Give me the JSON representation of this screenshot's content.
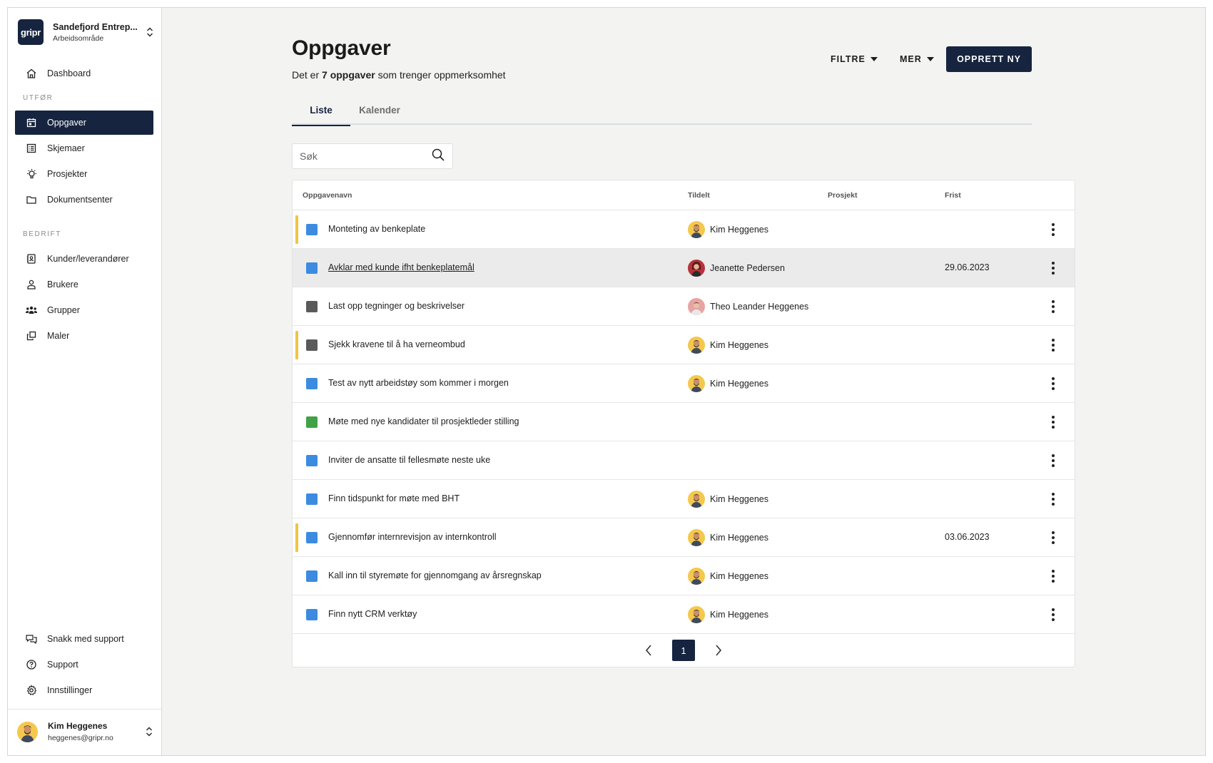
{
  "org": {
    "logo": "gripr",
    "name": "Sandefjord Entrep...",
    "subtitle": "Arbeidsområde"
  },
  "nav": {
    "dashboard": "Dashboard",
    "section_utfor": "UTFØR",
    "oppgaver": "Oppgaver",
    "skjemaer": "Skjemaer",
    "prosjekter": "Prosjekter",
    "dokumentsenter": "Dokumentsenter",
    "section_bedrift": "BEDRIFT",
    "kunder": "Kunder/leverandører",
    "brukere": "Brukere",
    "grupper": "Grupper",
    "maler": "Maler",
    "snakk": "Snakk med support",
    "support": "Support",
    "innstillinger": "Innstillinger"
  },
  "user": {
    "name": "Kim Heggenes",
    "email": "heggenes@gripr.no"
  },
  "page": {
    "title": "Oppgaver",
    "subtitle_pre": "Det er ",
    "subtitle_bold": "7 oppgaver",
    "subtitle_post": " som trenger oppmerksomhet"
  },
  "header": {
    "filter": "FILTRE",
    "more": "MER",
    "create": "OPPRETT NY"
  },
  "tabs": {
    "list": "Liste",
    "calendar": "Kalender"
  },
  "search": {
    "placeholder": "Søk"
  },
  "table": {
    "headers": {
      "name": "Oppgavenavn",
      "assigned": "Tildelt",
      "project": "Prosjekt",
      "due": "Frist"
    },
    "rows": [
      {
        "name": "Monteting av benkeplate",
        "assignee": "Kim Heggenes",
        "due": ""
      },
      {
        "name": "Avklar med kunde ifht benkeplatemål",
        "assignee": "Jeanette Pedersen",
        "due": "29.06.2023"
      },
      {
        "name": "Last opp tegninger og beskrivelser",
        "assignee": "Theo Leander Heggenes",
        "due": ""
      },
      {
        "name": "Sjekk kravene til å ha verneombud",
        "assignee": "Kim Heggenes",
        "due": ""
      },
      {
        "name": "Test av nytt arbeidstøy som kommer i morgen",
        "assignee": "Kim Heggenes",
        "due": ""
      },
      {
        "name": "Møte med nye kandidater til prosjektleder stilling",
        "assignee": "",
        "due": ""
      },
      {
        "name": "Inviter de ansatte til fellesmøte neste uke",
        "assignee": "",
        "due": ""
      },
      {
        "name": "Finn tidspunkt for møte med BHT",
        "assignee": "Kim Heggenes",
        "due": ""
      },
      {
        "name": "Gjennomfør internrevisjon av internkontroll",
        "assignee": "Kim Heggenes",
        "due": "03.06.2023"
      },
      {
        "name": "Kall inn til styremøte for gjennomgang av årsregnskap",
        "assignee": "Kim Heggenes",
        "due": ""
      },
      {
        "name": "Finn nytt CRM verktøy",
        "assignee": "Kim Heggenes",
        "due": ""
      }
    ]
  },
  "pagination": {
    "current": "1"
  },
  "colors": {
    "navy": "#16243f",
    "blue": "#3c8be0",
    "gray": "#5a5a5a",
    "green": "#42a046",
    "priority": "#f0c543"
  }
}
